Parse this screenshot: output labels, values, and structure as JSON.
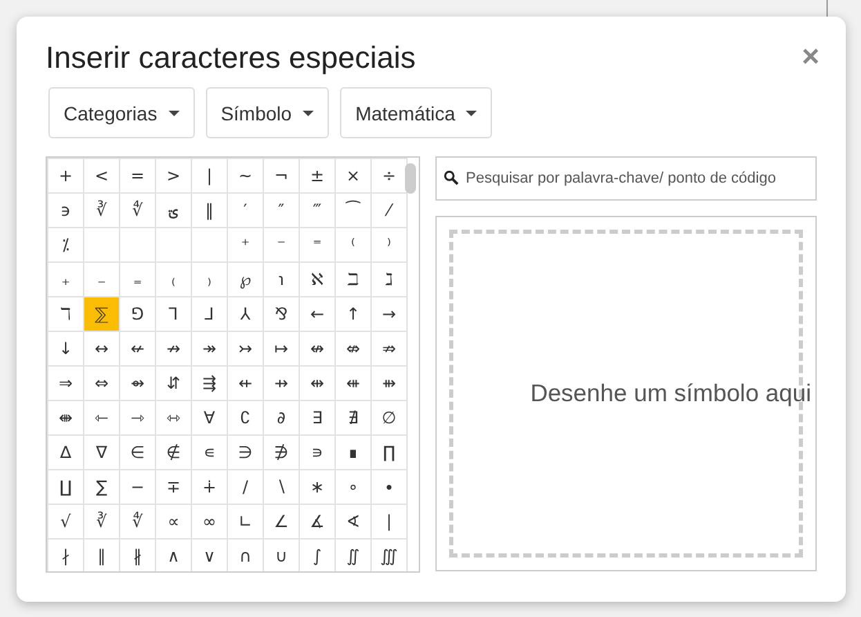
{
  "dialog": {
    "title": "Inserir caracteres especiais",
    "close": "×"
  },
  "dropdowns": [
    {
      "label": "Categorias"
    },
    {
      "label": "Símbolo"
    },
    {
      "label": "Matemática"
    }
  ],
  "grid": {
    "rows": [
      [
        {
          "kind": "symbol",
          "char": "+",
          "selected": false
        },
        {
          "kind": "symbol",
          "char": "<",
          "selected": false
        },
        {
          "kind": "symbol",
          "char": "=",
          "selected": false
        },
        {
          "kind": "symbol",
          "char": ">",
          "selected": false
        },
        {
          "kind": "symbol",
          "char": "|",
          "selected": false
        },
        {
          "kind": "symbol",
          "char": "~",
          "selected": false
        },
        {
          "kind": "symbol",
          "char": "¬",
          "selected": false
        },
        {
          "kind": "symbol",
          "char": "±",
          "selected": false
        },
        {
          "kind": "symbol",
          "char": "×",
          "selected": false
        },
        {
          "kind": "symbol",
          "char": "÷",
          "selected": false
        }
      ],
      [
        {
          "kind": "symbol",
          "char": "϶",
          "selected": false
        },
        {
          "kind": "symbol",
          "char": "∛",
          "selected": false
        },
        {
          "kind": "symbol",
          "char": "∜",
          "selected": false
        },
        {
          "kind": "symbol",
          "char": "ؾ",
          "selected": false
        },
        {
          "kind": "symbol",
          "char": "‖",
          "selected": false
        },
        {
          "kind": "symbol",
          "char": "′",
          "selected": false
        },
        {
          "kind": "symbol",
          "char": "″",
          "selected": false
        },
        {
          "kind": "symbol",
          "char": "‴",
          "selected": false
        },
        {
          "kind": "symbol",
          "char": "⁀",
          "selected": false
        },
        {
          "kind": "symbol",
          "char": "⁄",
          "selected": false
        }
      ],
      [
        {
          "kind": "symbol",
          "char": "⁒",
          "selected": false
        },
        {
          "kind": "blank"
        },
        {
          "kind": "blank"
        },
        {
          "kind": "blank"
        },
        {
          "kind": "blank"
        },
        {
          "kind": "symbol",
          "char": "⁺",
          "selected": false
        },
        {
          "kind": "symbol",
          "char": "⁻",
          "selected": false
        },
        {
          "kind": "symbol",
          "char": "⁼",
          "selected": false
        },
        {
          "kind": "symbol",
          "char": "⁽",
          "selected": false
        },
        {
          "kind": "symbol",
          "char": "⁾",
          "selected": false
        }
      ],
      [
        {
          "kind": "symbol",
          "char": "₊",
          "selected": false
        },
        {
          "kind": "symbol",
          "char": "₋",
          "selected": false
        },
        {
          "kind": "symbol",
          "char": "₌",
          "selected": false
        },
        {
          "kind": "symbol",
          "char": "₍",
          "selected": false
        },
        {
          "kind": "symbol",
          "char": "₎",
          "selected": false
        },
        {
          "kind": "symbol",
          "char": "℘",
          "selected": false
        },
        {
          "kind": "symbol",
          "char": "℩",
          "selected": false
        },
        {
          "kind": "symbol",
          "char": "ℵ",
          "selected": false
        },
        {
          "kind": "symbol",
          "char": "ℶ",
          "selected": false
        },
        {
          "kind": "symbol",
          "char": "ℷ",
          "selected": false
        }
      ],
      [
        {
          "kind": "symbol",
          "char": "ℸ",
          "selected": false
        },
        {
          "kind": "symbol",
          "char": "⅀",
          "selected": true
        },
        {
          "kind": "symbol",
          "char": "⅁",
          "selected": false
        },
        {
          "kind": "symbol",
          "char": "⅂",
          "selected": false
        },
        {
          "kind": "symbol",
          "char": "⅃",
          "selected": false
        },
        {
          "kind": "symbol",
          "char": "⅄",
          "selected": false
        },
        {
          "kind": "symbol",
          "char": "⅋",
          "selected": false
        },
        {
          "kind": "symbol",
          "char": "←",
          "selected": false
        },
        {
          "kind": "symbol",
          "char": "↑",
          "selected": false
        },
        {
          "kind": "symbol",
          "char": "→",
          "selected": false
        }
      ],
      [
        {
          "kind": "symbol",
          "char": "↓",
          "selected": false
        },
        {
          "kind": "symbol",
          "char": "↔",
          "selected": false
        },
        {
          "kind": "symbol",
          "char": "↚",
          "selected": false
        },
        {
          "kind": "symbol",
          "char": "↛",
          "selected": false
        },
        {
          "kind": "symbol",
          "char": "↠",
          "selected": false
        },
        {
          "kind": "symbol",
          "char": "↣",
          "selected": false
        },
        {
          "kind": "symbol",
          "char": "↦",
          "selected": false
        },
        {
          "kind": "symbol",
          "char": "↮",
          "selected": false
        },
        {
          "kind": "symbol",
          "char": "⇎",
          "selected": false
        },
        {
          "kind": "symbol",
          "char": "⇏",
          "selected": false
        }
      ],
      [
        {
          "kind": "symbol",
          "char": "⇒",
          "selected": false
        },
        {
          "kind": "symbol",
          "char": "⇔",
          "selected": false
        },
        {
          "kind": "symbol",
          "char": "⇴",
          "selected": false
        },
        {
          "kind": "symbol",
          "char": "⇵",
          "selected": false
        },
        {
          "kind": "symbol",
          "char": "⇶",
          "selected": false
        },
        {
          "kind": "symbol",
          "char": "⇷",
          "selected": false
        },
        {
          "kind": "symbol",
          "char": "⇸",
          "selected": false
        },
        {
          "kind": "symbol",
          "char": "⇹",
          "selected": false
        },
        {
          "kind": "symbol",
          "char": "⇺",
          "selected": false
        },
        {
          "kind": "symbol",
          "char": "⇻",
          "selected": false
        }
      ],
      [
        {
          "kind": "symbol",
          "char": "⇼",
          "selected": false
        },
        {
          "kind": "symbol",
          "char": "⇽",
          "selected": false
        },
        {
          "kind": "symbol",
          "char": "⇾",
          "selected": false
        },
        {
          "kind": "symbol",
          "char": "⇿",
          "selected": false
        },
        {
          "kind": "symbol",
          "char": "∀",
          "selected": false
        },
        {
          "kind": "symbol",
          "char": "∁",
          "selected": false
        },
        {
          "kind": "symbol",
          "char": "∂",
          "selected": false
        },
        {
          "kind": "symbol",
          "char": "∃",
          "selected": false
        },
        {
          "kind": "symbol",
          "char": "∄",
          "selected": false
        },
        {
          "kind": "symbol",
          "char": "∅",
          "selected": false
        }
      ],
      [
        {
          "kind": "symbol",
          "char": "∆",
          "selected": false
        },
        {
          "kind": "symbol",
          "char": "∇",
          "selected": false
        },
        {
          "kind": "symbol",
          "char": "∈",
          "selected": false
        },
        {
          "kind": "symbol",
          "char": "∉",
          "selected": false
        },
        {
          "kind": "symbol",
          "char": "∊",
          "selected": false
        },
        {
          "kind": "symbol",
          "char": "∋",
          "selected": false
        },
        {
          "kind": "symbol",
          "char": "∌",
          "selected": false
        },
        {
          "kind": "symbol",
          "char": "∍",
          "selected": false
        },
        {
          "kind": "symbol",
          "char": "∎",
          "selected": false
        },
        {
          "kind": "symbol",
          "char": "∏",
          "selected": false
        }
      ],
      [
        {
          "kind": "symbol",
          "char": "∐",
          "selected": false
        },
        {
          "kind": "symbol",
          "char": "∑",
          "selected": false
        },
        {
          "kind": "symbol",
          "char": "−",
          "selected": false
        },
        {
          "kind": "symbol",
          "char": "∓",
          "selected": false
        },
        {
          "kind": "symbol",
          "char": "∔",
          "selected": false
        },
        {
          "kind": "symbol",
          "char": "∕",
          "selected": false
        },
        {
          "kind": "symbol",
          "char": "∖",
          "selected": false
        },
        {
          "kind": "symbol",
          "char": "∗",
          "selected": false
        },
        {
          "kind": "symbol",
          "char": "∘",
          "selected": false
        },
        {
          "kind": "symbol",
          "char": "∙",
          "selected": false
        }
      ],
      [
        {
          "kind": "symbol",
          "char": "√",
          "selected": false
        },
        {
          "kind": "symbol",
          "char": "∛",
          "selected": false
        },
        {
          "kind": "symbol",
          "char": "∜",
          "selected": false
        },
        {
          "kind": "symbol",
          "char": "∝",
          "selected": false
        },
        {
          "kind": "symbol",
          "char": "∞",
          "selected": false
        },
        {
          "kind": "symbol",
          "char": "∟",
          "selected": false
        },
        {
          "kind": "symbol",
          "char": "∠",
          "selected": false
        },
        {
          "kind": "symbol",
          "char": "∡",
          "selected": false
        },
        {
          "kind": "symbol",
          "char": "∢",
          "selected": false
        },
        {
          "kind": "symbol",
          "char": "∣",
          "selected": false
        }
      ],
      [
        {
          "kind": "symbol",
          "char": "∤",
          "selected": false
        },
        {
          "kind": "symbol",
          "char": "∥",
          "selected": false
        },
        {
          "kind": "symbol",
          "char": "∦",
          "selected": false
        },
        {
          "kind": "symbol",
          "char": "∧",
          "selected": false
        },
        {
          "kind": "symbol",
          "char": "∨",
          "selected": false
        },
        {
          "kind": "symbol",
          "char": "∩",
          "selected": false
        },
        {
          "kind": "symbol",
          "char": "∪",
          "selected": false
        },
        {
          "kind": "symbol",
          "char": "∫",
          "selected": false
        },
        {
          "kind": "symbol",
          "char": "∬",
          "selected": false
        },
        {
          "kind": "symbol",
          "char": "∭",
          "selected": false
        }
      ]
    ]
  },
  "search": {
    "placeholder": "Pesquisar por palavra-chave/ ponto de código"
  },
  "draw_area": {
    "hint": "Desenhe um símbolo aqui"
  }
}
